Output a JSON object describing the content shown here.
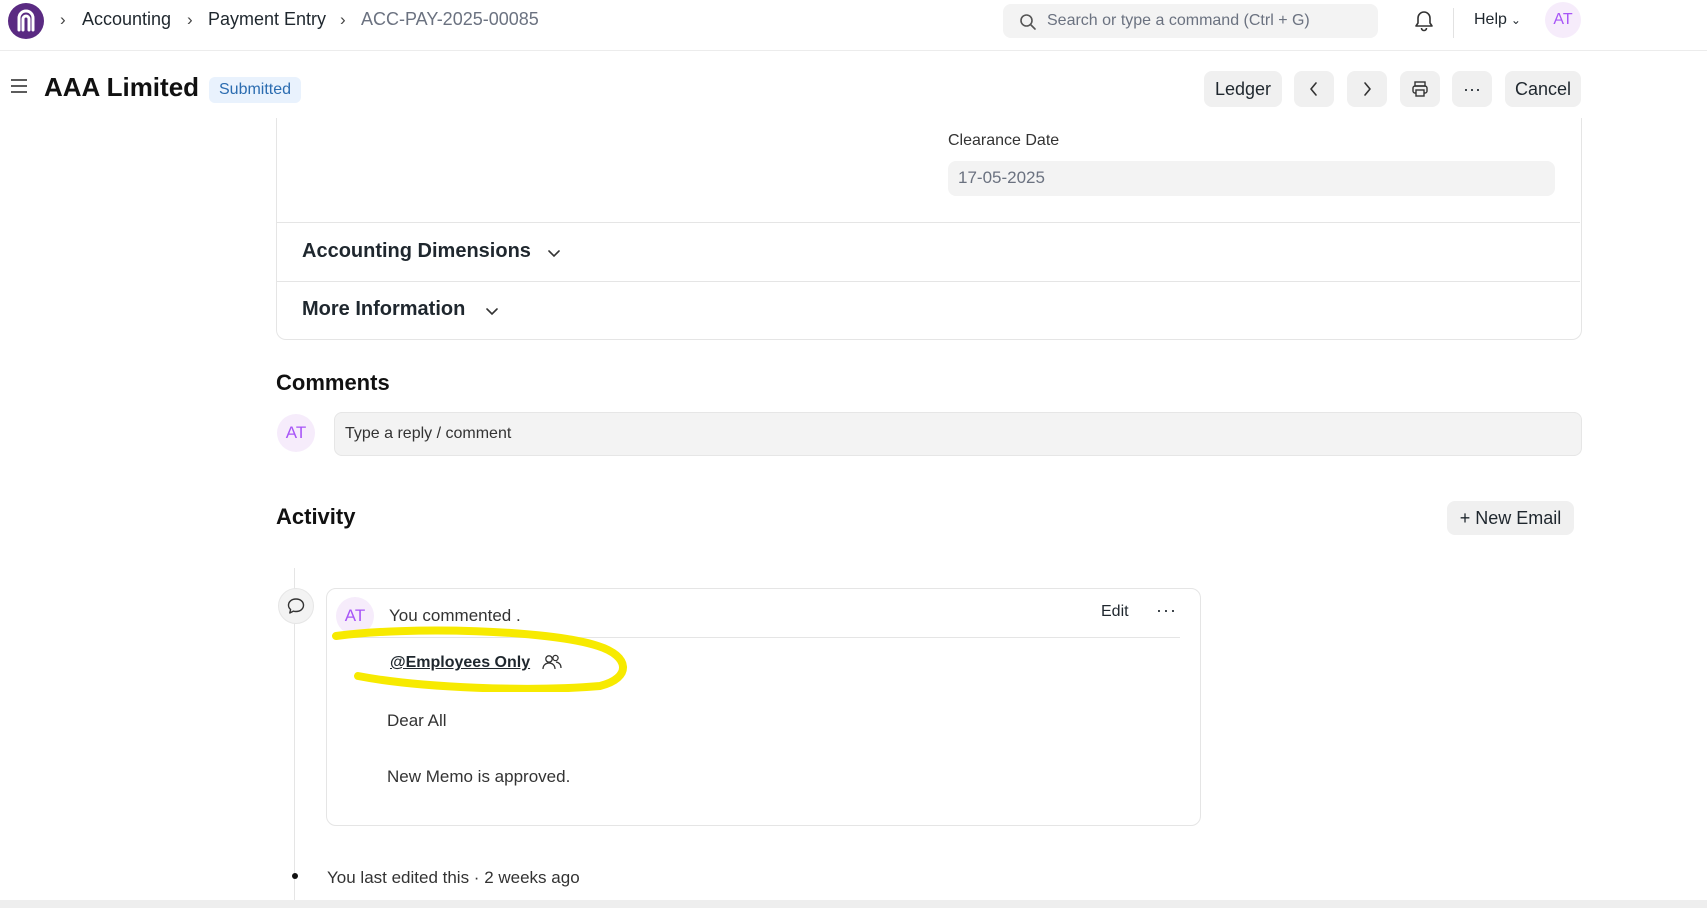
{
  "nav": {
    "breadcrumbs": [
      "Accounting",
      "Payment Entry",
      "ACC-PAY-2025-00085"
    ],
    "search_placeholder": "Search or type a command (Ctrl + G)",
    "help_label": "Help",
    "user_initials": "AT"
  },
  "header": {
    "title": "AAA Limited",
    "status": "Submitted",
    "ledger_label": "Ledger",
    "more_label": "···",
    "cancel_label": "Cancel"
  },
  "form": {
    "clearance_date_label": "Clearance Date",
    "clearance_date_value": "17-05-2025",
    "sections": [
      "Accounting Dimensions",
      "More Information"
    ]
  },
  "comments": {
    "heading": "Comments",
    "avatar": "AT",
    "placeholder": "Type a reply / comment"
  },
  "activity": {
    "heading": "Activity",
    "new_email_label": "+ New Email",
    "entry": {
      "avatar": "AT",
      "author_text": "You commented .",
      "edit_label": "Edit",
      "more_label": "···",
      "mention": "@Employees Only",
      "lines": [
        "Dear All",
        "New Memo is approved."
      ]
    },
    "last_edit": "You last edited this · 2 weeks ago"
  },
  "colors": {
    "brand": "#5a2a82",
    "highlight": "#f7ea00",
    "badge_bg": "#e9f2fd",
    "badge_text": "#2b6cb0"
  }
}
